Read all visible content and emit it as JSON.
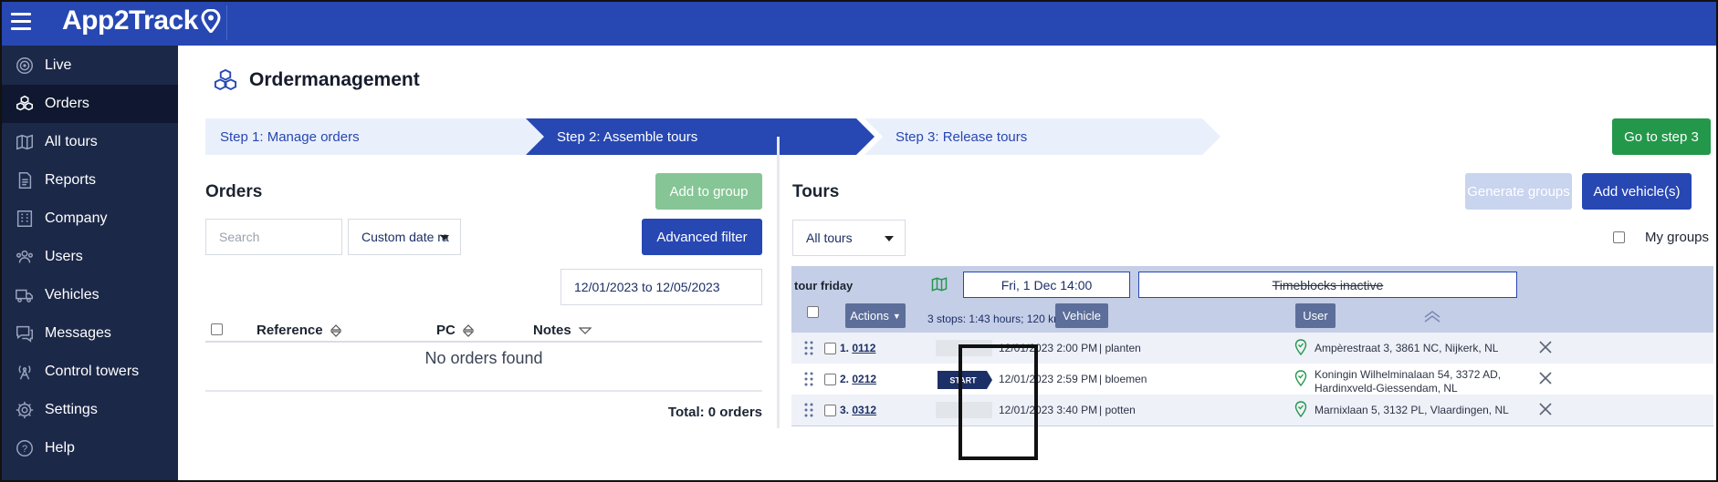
{
  "topbar": {
    "brand": "App2Track"
  },
  "sidebar": {
    "items": [
      {
        "label": "Live",
        "icon": "live-icon"
      },
      {
        "label": "Orders",
        "icon": "boxes-icon",
        "active": true
      },
      {
        "label": "All tours",
        "icon": "map-icon"
      },
      {
        "label": "Reports",
        "icon": "report-icon"
      },
      {
        "label": "Company",
        "icon": "building-icon"
      },
      {
        "label": "Users",
        "icon": "users-icon"
      },
      {
        "label": "Vehicles",
        "icon": "truck-icon"
      },
      {
        "label": "Messages",
        "icon": "messages-icon"
      },
      {
        "label": "Control towers",
        "icon": "antenna-icon"
      },
      {
        "label": "Settings",
        "icon": "gear-icon"
      },
      {
        "label": "Help",
        "icon": "help-icon"
      }
    ]
  },
  "page": {
    "title": "Ordermanagement"
  },
  "steps": [
    {
      "label": "Step 1: Manage orders",
      "state": "done"
    },
    {
      "label": "Step 2: Assemble tours",
      "state": "active"
    },
    {
      "label": "Step 3: Release tours",
      "state": "upcoming"
    }
  ],
  "go_step3_label": "Go to step 3",
  "orders": {
    "title": "Orders",
    "add_to_group": "Add to group",
    "search_placeholder": "Search",
    "date_select": "Custom date ra",
    "advanced_filter": "Advanced filter",
    "date_range": "12/01/2023 to 12/05/2023",
    "columns": [
      "Reference",
      "PC",
      "Notes"
    ],
    "empty": "No orders found",
    "total": "Total: 0 orders"
  },
  "tours": {
    "title": "Tours",
    "generate_groups": "Generate groups",
    "add_vehicles": "Add vehicle(s)",
    "filter": "All tours",
    "my_groups": "My groups",
    "tour": {
      "name": "tour friday",
      "date": "Fri, 1 Dec 14:00",
      "timeblocks": "Timeblocks inactive",
      "actions": "Actions",
      "summary": "3 stops: 1:43 hours; 120 km",
      "vehicle": "Vehicle",
      "user": "User",
      "start_label": "START",
      "stops": [
        {
          "num": "1.",
          "ref": "0112",
          "time": "12/01/2023 2:00 PM",
          "note": "| planten",
          "address": "Ampèrestraat 3, 3861 NC, Nijkerk, NL"
        },
        {
          "num": "2.",
          "ref": "0212",
          "time": "12/01/2023 2:59 PM",
          "note": "| bloemen",
          "address": "Koningin Wilhelminalaan 54, 3372 AD, Hardinxveld-Giessendam, NL"
        },
        {
          "num": "3.",
          "ref": "0312",
          "time": "12/01/2023 3:40 PM",
          "note": "| potten",
          "address": "Marnixlaan 5, 3132 PL, Vlaardingen, NL"
        }
      ]
    }
  },
  "colors": {
    "brand_blue": "#2747b3",
    "sidebar": "#1c2848",
    "success": "#23984a"
  }
}
